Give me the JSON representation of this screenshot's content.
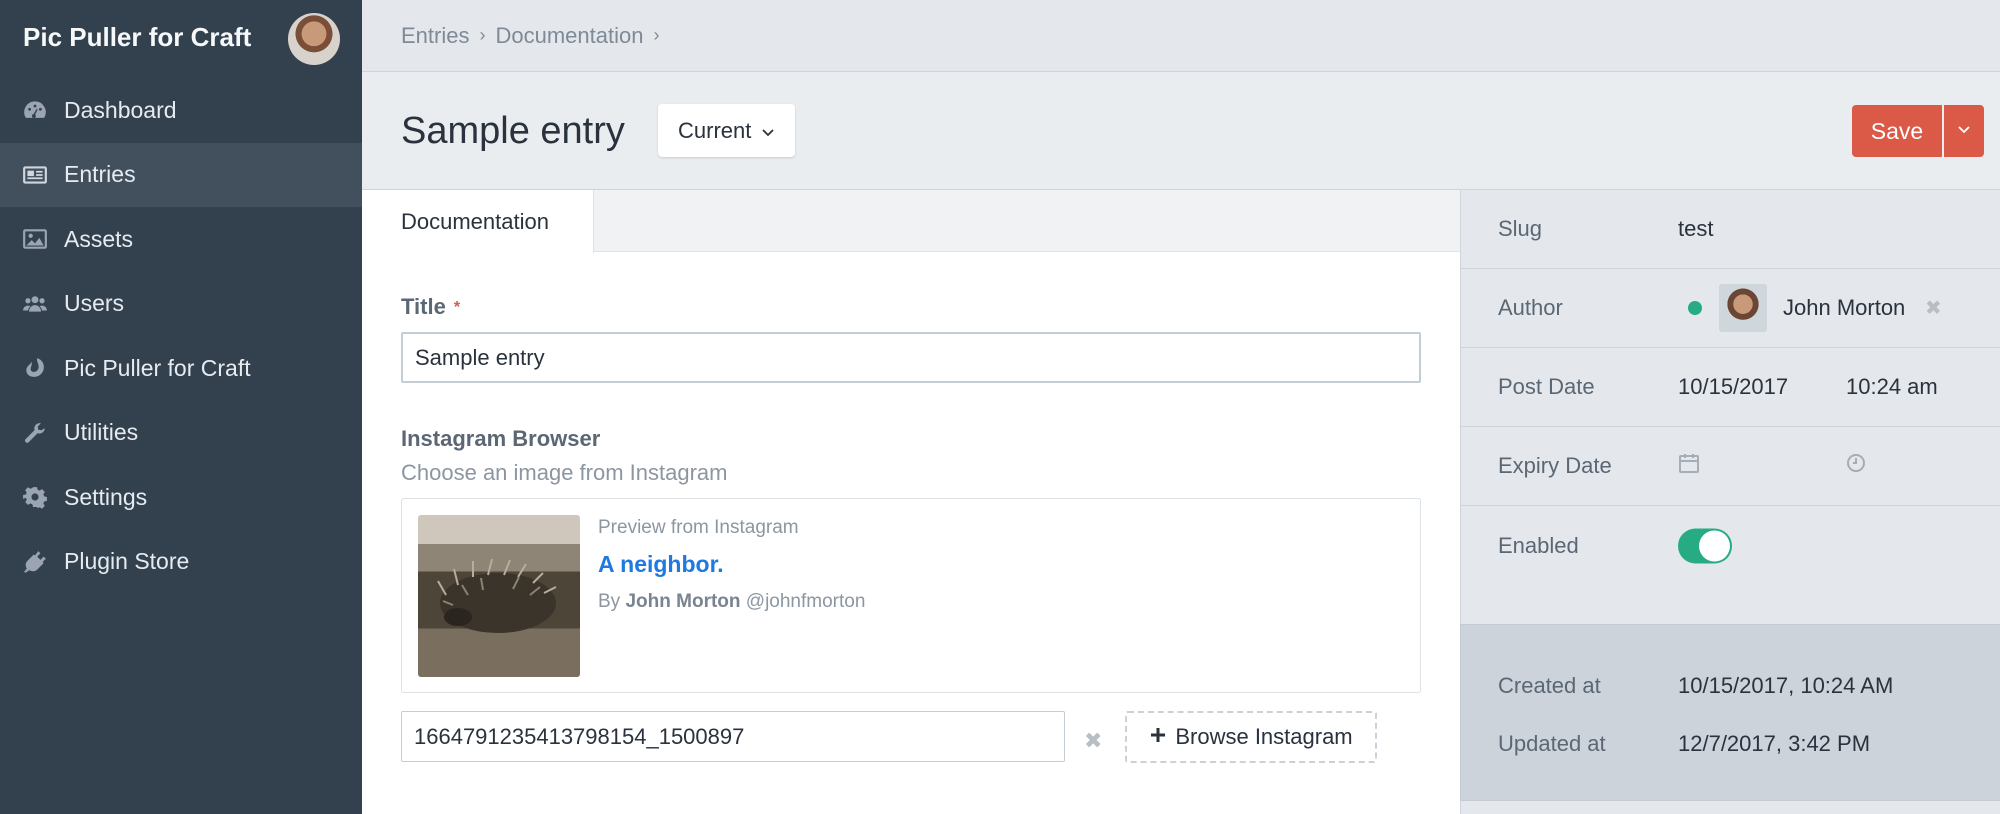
{
  "sidebar": {
    "site_name": "Pic Puller for Craft",
    "items": [
      {
        "label": "Dashboard",
        "icon": "dashboard-icon"
      },
      {
        "label": "Entries",
        "icon": "newspaper-icon",
        "active": true
      },
      {
        "label": "Assets",
        "icon": "image-icon"
      },
      {
        "label": "Users",
        "icon": "users-icon"
      },
      {
        "label": "Pic Puller for Craft",
        "icon": "plugin-leaf-icon"
      },
      {
        "label": "Utilities",
        "icon": "wrench-icon"
      },
      {
        "label": "Settings",
        "icon": "gear-icon"
      },
      {
        "label": "Plugin Store",
        "icon": "plug-icon"
      }
    ]
  },
  "breadcrumbs": [
    "Entries",
    "Documentation"
  ],
  "header": {
    "title": "Sample entry",
    "revision": "Current",
    "save_label": "Save"
  },
  "tabs": [
    "Documentation"
  ],
  "fields": {
    "title": {
      "label": "Title",
      "value": "Sample entry",
      "required_mark": "*"
    },
    "instagram": {
      "label": "Instagram Browser",
      "instructions": "Choose an image from Instagram",
      "preview_from": "Preview from Instagram",
      "caption": "A neighbor.",
      "by_prefix": "By",
      "author_name": "John Morton",
      "author_handle": "@johnfmorton",
      "media_id": "1664791235413798154_1500897",
      "browse_label": "Browse Instagram"
    }
  },
  "meta": {
    "slug_label": "Slug",
    "slug": "test",
    "author_label": "Author",
    "author": "John Morton",
    "post_date_label": "Post Date",
    "post_date": "10/15/2017",
    "post_time": "10:24 am",
    "expiry_date_label": "Expiry Date",
    "enabled_label": "Enabled",
    "enabled": true,
    "created_label": "Created at",
    "created_at": "10/15/2017, 10:24 AM",
    "updated_label": "Updated at",
    "updated_at": "12/7/2017, 3:42 PM"
  },
  "colors": {
    "sidebar_bg": "#33414f",
    "save_button": "#da5a47",
    "link": "#1f79e0",
    "toggle_on": "#27ab83"
  }
}
